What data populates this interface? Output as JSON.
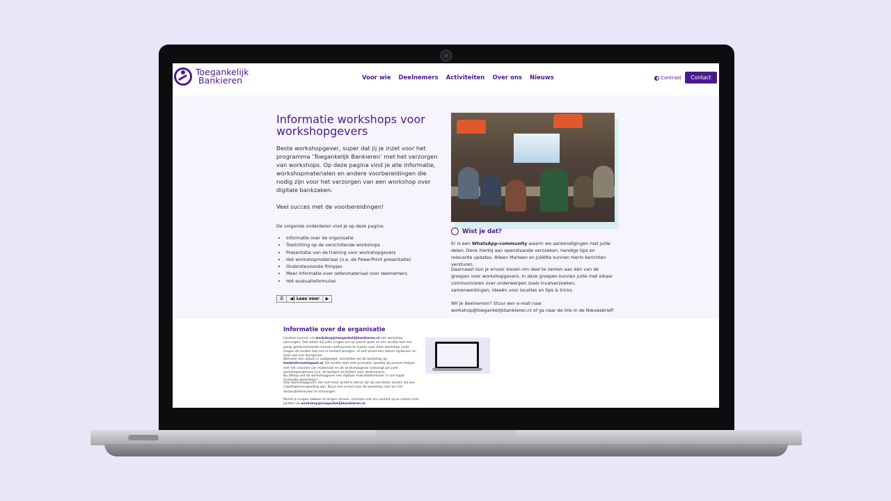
{
  "header": {
    "logo_line1": "Toegankelijk",
    "logo_line2": "Bankieren",
    "nav": [
      "Voor wie",
      "Deelnemers",
      "Activiteiten",
      "Over ons",
      "Nieuws"
    ],
    "contrast_label": "Contrast",
    "contact_label": "Contact"
  },
  "hero": {
    "title": "Informatie workshops voor workshopgevers",
    "intro": "Beste workshopgever, super dat jij je inzet voor het programma ‘Toegankelijk Bankieren’ met het verzorgen van workshops. Op deze pagina vind je alle informatie, workshopmaterialen en andere voorbereidingen die nodig zijn voor het verzorgen van een workshop over digitale bankzaken.",
    "wish": "Veel succes met de voorbereidingen!",
    "list_intro": "De volgende onderdelen vind je op deze pagina:",
    "topics": [
      "Informatie over de organisatie",
      "Toelichting op de verschillende workshops",
      "Presentatie van de training voor workshopgevers",
      "Het workshopmateriaal (o.a. de PowerPoint presentatie)",
      "Ondersteunende filmpjes",
      "Meer informatie over oefenmateriaal voor deelnemers",
      "Het evaluatieformulier"
    ],
    "readspeaker": {
      "menu": "☰",
      "play_label": "◀) Lees voor",
      "next": "▶"
    }
  },
  "tip": {
    "title": "Wist je dat?",
    "p1_before": "Er is een ",
    "p1_bold": "WhatsApp-community",
    "p1_after": " waarin we aankondigingen met jullie delen. Denk hierbij aan openstaande verzoeken, handige tips en relevante updates. Alleen Marleen en Juliëtte kunnen hierin berichten versturen.",
    "p2": "Daarnaast kun je ervoor kiezen om deel te nemen aan één van de groepen voor workshopgevers. In deze groepen kunnen jullie met elkaar communiceren over onderwerpen zoals invalverzoeken, samenwerkingen, ideeën voor locaties en tips & tricks.",
    "p3": "Wil je deelnemen? Stuur een e-mail naar workshop@toegankelijkbankieren.nl of ga naar de link in de Nieuwsbrief!"
  },
  "organisation": {
    "title": "Informatie over de organisatie",
    "p1_a": "Locaties kunnen via ",
    "p1_email": "workshop@toegankelijkbankieren.nl",
    "p1_b": " een workshop aanvragen. Ook willen wij jullie vragen om op pad te gaan en een locatie met een groep geïnteresseerde mensen enthousiast te maken voor deze workshop. Jullie mogen de locatie met ons in contact brengen, of zelf alvast een datum inplannen en deze aan ons doorgeven.",
    "p2_a": "Wanneer een datum is vastgelegd, vermelden wij de workshop op ",
    "p2_link": "bankinformatiepunt.nl",
    "p2_b": ". De locatie start met promotie (waarbij wij kunnen helpen met het voorzien van materiaal) en de workshopgever ontvangt per post workshopmateriaal (o.a. de boekjes en folders voor deelnemers).",
    "p3": "Na afloop vult de workshopgever een digitaal evaluatieformulier in (zie kopje 'Evaluatie workshops').",
    "p4": "Voor workshopgevers die niet meer actief in dienst zijn bij een bank, bieden wij een vrijwilligersvergoeding aan. Stuur een e-mail naar de workshop mail om het declaratieformulier te ontvangen.",
    "p5_a": "Mocht je vragen hebben of dingen missen, schroom niet om contact op te nemen met Juliëtte via ",
    "p5_email": "workshop@toegankelijkbankieren.nl",
    "p5_b": "."
  },
  "colors": {
    "brand_purple": "#4a1a8c",
    "hero_bg": "#f7f4fd",
    "page_bg": "#ebe6f7"
  }
}
